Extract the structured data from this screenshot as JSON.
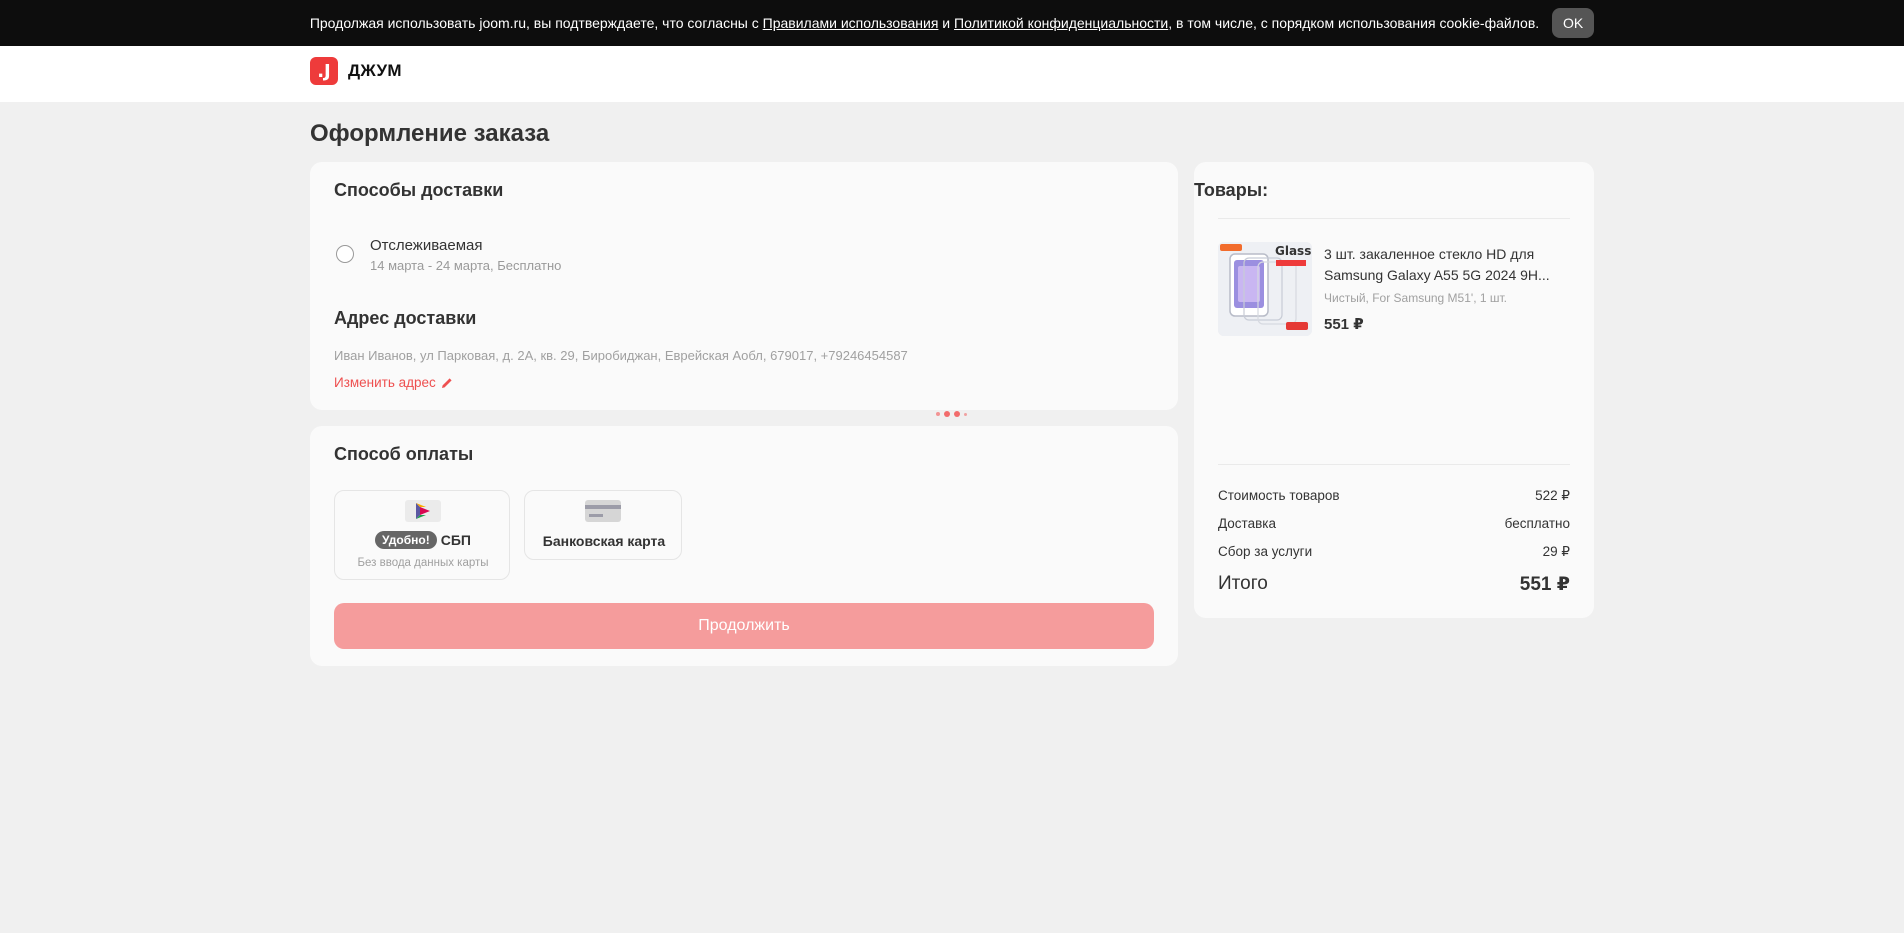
{
  "cookie_bar": {
    "text_before": "Продолжая использовать joom.ru, вы подтверждаете, что согласны с ",
    "terms_link": "Правилами использования",
    "and": " и ",
    "privacy_link": "Политикой конфиденциальности",
    "text_after": ", в том числе, с порядком использования cookie-файлов.",
    "ok_label": "OK"
  },
  "header": {
    "logo_mark": ".J",
    "logo_text": "ДЖУМ"
  },
  "page_title": "Оформление заказа",
  "delivery": {
    "title": "Способы доставки",
    "option_name": "Отслеживаемая",
    "option_details": "14 марта - 24 марта, Бесплатно",
    "option_selected": false,
    "address_title": "Адрес доставки",
    "address": "Иван Иванов, ул Парковая, д. 2А, кв. 29, Биробиджан, Еврейская Аобл, 679017, +79246454587",
    "change_address_label": "Изменить адрес"
  },
  "payment": {
    "title": "Способ оплаты",
    "sbp_badge": "Удобно!",
    "sbp_label": "СБП",
    "sbp_sub": "Без ввода данных карты",
    "card_label": "Банковская карта",
    "continue_label": "Продолжить"
  },
  "summary": {
    "title": "Товары:",
    "product": {
      "name": "3 шт. закаленное стекло HD для Samsung Galaxy A55 5G 2024 9H...",
      "variant": "Чистый, For Samsung M51', 1 шт.",
      "price": "551 ₽",
      "image_text": "Glass"
    },
    "rows": [
      {
        "label": "Стоимость товаров",
        "value": "522 ₽"
      },
      {
        "label": "Доставка",
        "value": "бесплатно"
      },
      {
        "label": "Сбор за услуги",
        "value": "29 ₽"
      }
    ],
    "total_label": "Итого",
    "total_value": "551 ₽"
  },
  "colors": {
    "accent": "#ee3b3b",
    "button_disabled": "#f59c9c",
    "link": "#ee5050"
  }
}
